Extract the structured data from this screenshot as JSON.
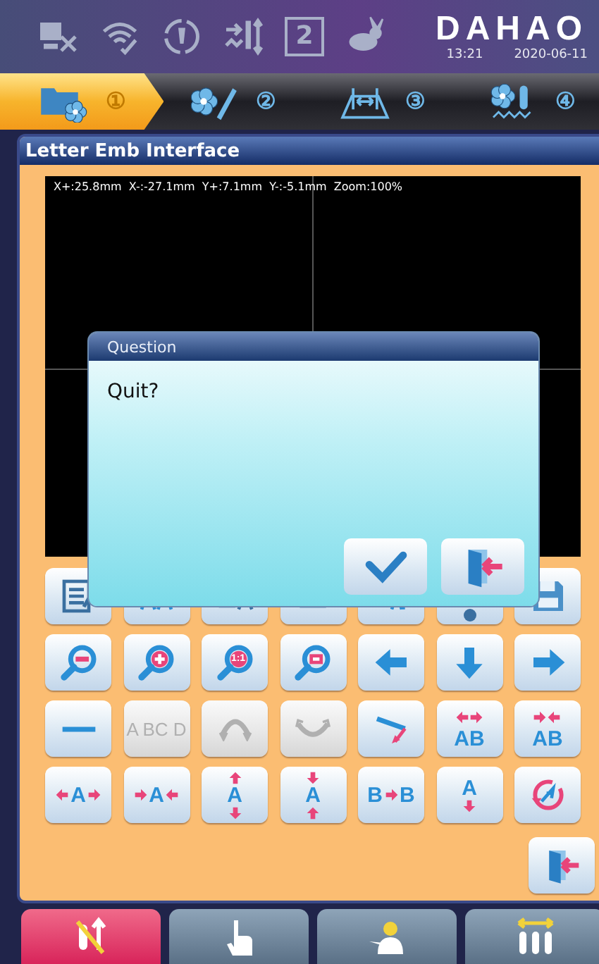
{
  "status_bar": {
    "icons": [
      {
        "kind": "network"
      },
      {
        "kind": "wifi"
      },
      {
        "kind": "rotate"
      },
      {
        "kind": "needle"
      },
      {
        "kind": "number",
        "text": "2"
      },
      {
        "kind": "rabbit"
      }
    ],
    "brand": "DAHAO",
    "time": "13:21",
    "date": "2020-06-11"
  },
  "steps": [
    {
      "kind": "folder",
      "number": "①",
      "selected": true
    },
    {
      "kind": "flower-pen",
      "number": "②",
      "selected": false
    },
    {
      "kind": "frame",
      "number": "③",
      "selected": false
    },
    {
      "kind": "flower-needle",
      "number": "④",
      "selected": false
    }
  ],
  "panel": {
    "title": "Letter Emb Interface",
    "readout": "X+:25.8mm  X-:-27.1mm  Y+:7.1mm  Y-:-5.1mm  Zoom:100%"
  },
  "tool_rows": [
    [
      {
        "kind": "list-edit",
        "disabled": false
      },
      {
        "kind": "letters-pair",
        "disabled": false
      },
      {
        "kind": "align",
        "disabled": false
      },
      {
        "kind": "box",
        "disabled": false
      },
      {
        "kind": "to-ab",
        "disabled": false
      },
      {
        "kind": "dot",
        "disabled": false
      },
      {
        "kind": "save",
        "disabled": false
      }
    ],
    [
      {
        "kind": "zoom-out",
        "disabled": false
      },
      {
        "kind": "zoom-in",
        "disabled": false
      },
      {
        "kind": "zoom-actual",
        "text": "1:1",
        "disabled": false
      },
      {
        "kind": "zoom-fit",
        "disabled": false
      },
      {
        "kind": "arrow-left",
        "disabled": false
      },
      {
        "kind": "arrow-down",
        "disabled": false
      },
      {
        "kind": "arrow-right",
        "disabled": false
      }
    ],
    [
      {
        "kind": "line",
        "disabled": false
      },
      {
        "kind": "arc-text",
        "text": "A BC D",
        "disabled": true
      },
      {
        "kind": "arc-up",
        "disabled": true
      },
      {
        "kind": "arc-down",
        "disabled": true
      },
      {
        "kind": "slant",
        "disabled": false
      },
      {
        "kind": "spread",
        "text": "AB",
        "disabled": false
      },
      {
        "kind": "condense",
        "text": "AB",
        "disabled": false
      }
    ],
    [
      {
        "kind": "h-spread",
        "text": "A",
        "disabled": false
      },
      {
        "kind": "h-condense",
        "text": "A",
        "disabled": false
      },
      {
        "kind": "v-spread",
        "text": "A",
        "disabled": false
      },
      {
        "kind": "v-condense",
        "text": "A",
        "disabled": false
      },
      {
        "kind": "mirror",
        "text": "B",
        "text2": "B",
        "disabled": false
      },
      {
        "kind": "v-flip",
        "text": "A",
        "disabled": false
      },
      {
        "kind": "rotate-letter",
        "disabled": false
      }
    ]
  ],
  "exit_button": {
    "kind": "exit"
  },
  "dialog": {
    "title": "Question",
    "message": "Quit?",
    "buttons": [
      {
        "kind": "check"
      },
      {
        "kind": "exit"
      }
    ]
  },
  "bottom_bar": [
    {
      "kind": "needle-cross",
      "selected": true
    },
    {
      "kind": "hand",
      "selected": false
    },
    {
      "kind": "operator",
      "selected": false
    },
    {
      "kind": "needles",
      "selected": false
    }
  ]
}
